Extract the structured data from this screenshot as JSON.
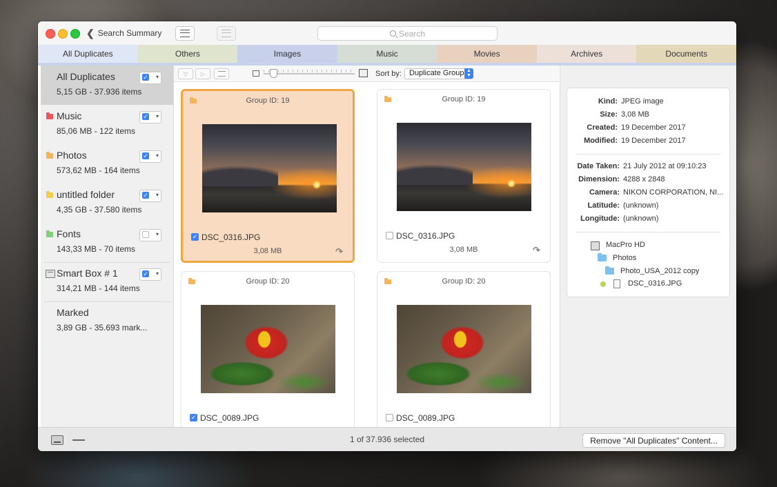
{
  "titlebar": {
    "back_label": "Search Summary",
    "search_placeholder": "Search"
  },
  "tabs": [
    {
      "label": "All Duplicates",
      "color": "#dfe6f5"
    },
    {
      "label": "Others",
      "color": "#dfe4cf"
    },
    {
      "label": "Images",
      "color": "#c9d0ea"
    },
    {
      "label": "Music",
      "color": "#d5ddd4"
    },
    {
      "label": "Movies",
      "color": "#e8d2bf"
    },
    {
      "label": "Archives",
      "color": "#ede0d8"
    },
    {
      "label": "Documents",
      "color": "#e3d8b7"
    }
  ],
  "sidebar": {
    "items": [
      {
        "title": "All Duplicates",
        "sub": "5,15 GB - 37.936 items",
        "checked": true
      },
      {
        "title": "Music",
        "sub": "85,06 MB - 122 items",
        "checked": true,
        "folder_color": "#e7575b"
      },
      {
        "title": "Photos",
        "sub": "573,62 MB - 164 items",
        "checked": true,
        "folder_color": "#f4b458"
      },
      {
        "title": "untitled folder",
        "sub": "4,35 GB - 37.580 items",
        "checked": true,
        "folder_color": "#f2cc4a"
      },
      {
        "title": "Fonts",
        "sub": "143,33 MB - 70 items",
        "checked": false,
        "folder_color": "#7fd07a"
      },
      {
        "title": "Smart Box # 1",
        "sub": "314,21 MB - 144 items",
        "checked": true
      },
      {
        "title": "Marked",
        "sub": "3,89 GB - 35.693 mark..."
      }
    ]
  },
  "toolbar2": {
    "sort_label": "Sort by:",
    "sort_value": "Duplicate Group"
  },
  "cards": [
    {
      "group": "Group ID: 19",
      "name": "DSC_0316.JPG",
      "size": "3,08 MB",
      "checked": true,
      "selected": true
    },
    {
      "group": "Group ID: 19",
      "name": "DSC_0316.JPG",
      "size": "3,08 MB",
      "checked": false,
      "selected": false
    },
    {
      "group": "Group ID: 20",
      "name": "DSC_0089.JPG",
      "size": "",
      "checked": true,
      "selected": false
    },
    {
      "group": "Group ID: 20",
      "name": "DSC_0089.JPG",
      "size": "",
      "checked": false,
      "selected": false
    }
  ],
  "info": {
    "kind_k": "Kind:",
    "kind_v": "JPEG image",
    "size_k": "Size:",
    "size_v": "3,08 MB",
    "created_k": "Created:",
    "created_v": "19 December 2017",
    "modified_k": "Modified:",
    "modified_v": "19 December 2017",
    "taken_k": "Date Taken:",
    "taken_v": "21 July 2012 at 09:10:23",
    "dim_k": "Dimension:",
    "dim_v": "4288 x 2848",
    "camera_k": "Camera:",
    "camera_v": "NIKON CORPORATION, NI...",
    "lat_k": "Latitude:",
    "lat_v": "(unknown)",
    "lon_k": "Longitude:",
    "lon_v": "(unknown)",
    "path": [
      "MacPro HD",
      "Photos",
      "Photo_USA_2012 copy",
      "DSC_0316.JPG"
    ]
  },
  "bottom": {
    "status": "1 of 37.936 selected",
    "remove_label": "Remove \"All Duplicates\" Content..."
  }
}
